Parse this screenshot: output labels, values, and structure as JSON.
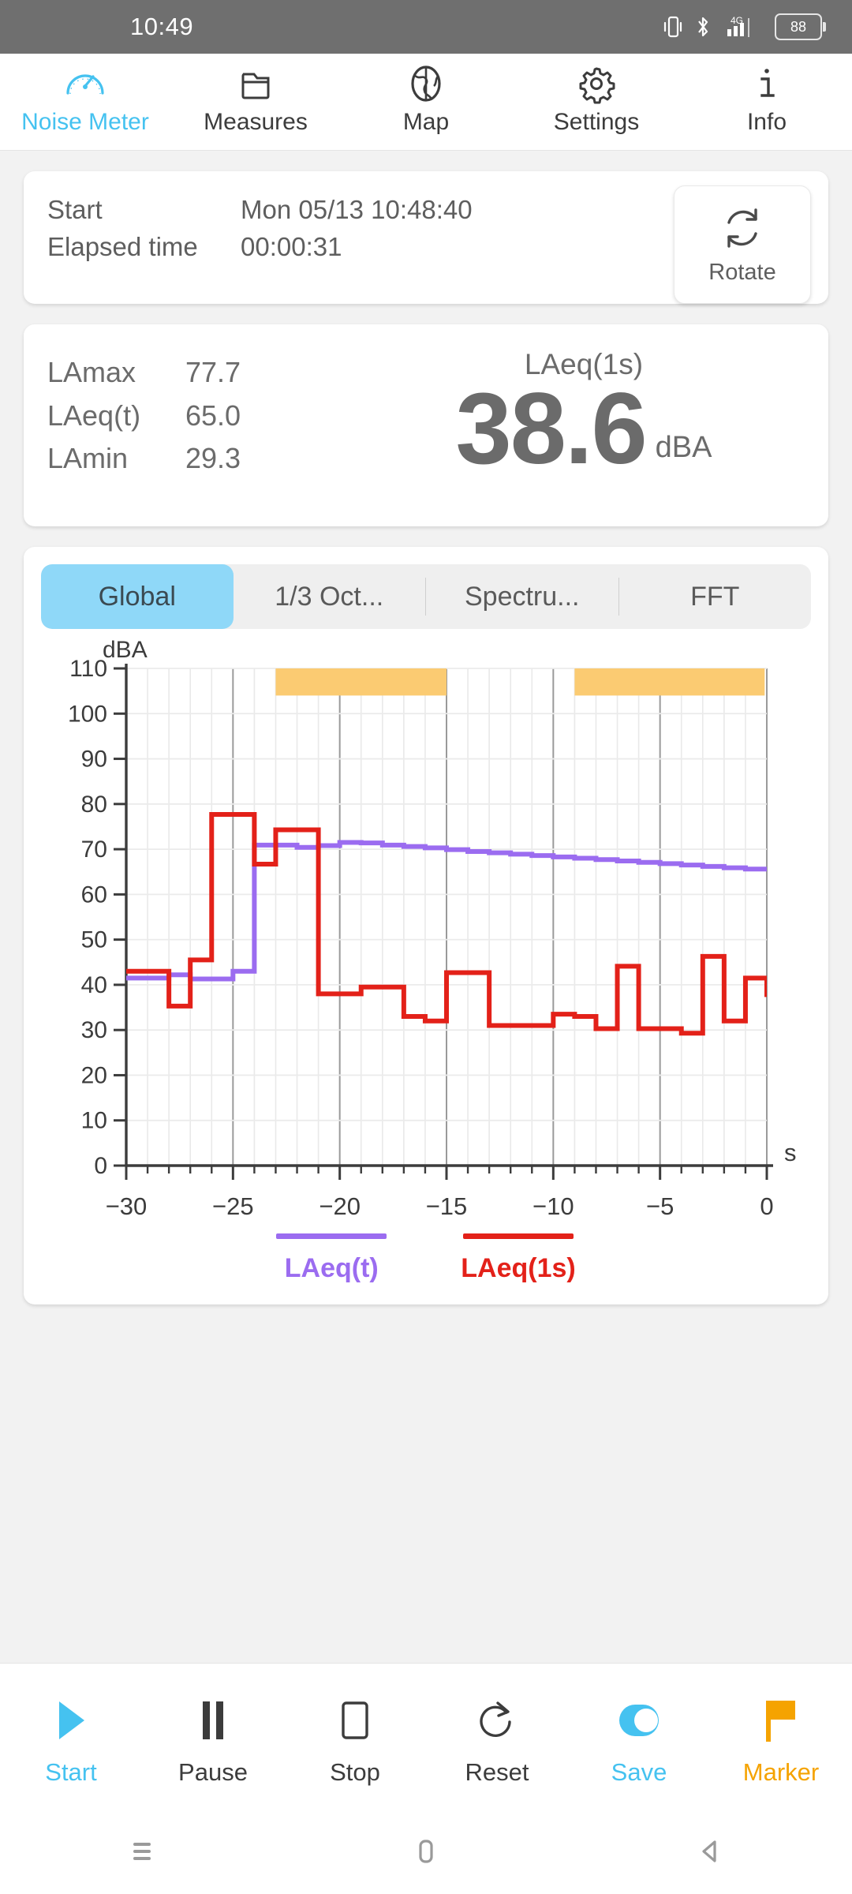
{
  "statusbar": {
    "time": "10:49",
    "battery": "88",
    "network": "4G",
    "icons": [
      "vibrate-icon",
      "bluetooth-icon",
      "signal-icon",
      "battery-icon"
    ]
  },
  "topnav": {
    "items": [
      {
        "label": "Noise Meter",
        "icon": "gauge-icon",
        "active": true
      },
      {
        "label": "Measures",
        "icon": "folder-icon",
        "active": false
      },
      {
        "label": "Map",
        "icon": "globe-icon",
        "active": false
      },
      {
        "label": "Settings",
        "icon": "gear-icon",
        "active": false
      },
      {
        "label": "Info",
        "icon": "info-icon",
        "active": false
      }
    ],
    "active_color": "#45c2f0"
  },
  "session": {
    "start_label": "Start",
    "start_value": "Mon 05/13 10:48:40",
    "elapsed_label": "Elapsed time",
    "elapsed_value": "00:00:31",
    "rotate_label": "Rotate",
    "rotate_icon": "rotate-icon"
  },
  "levels": {
    "lamax_label": "LAmax",
    "lamax_value": "77.7",
    "laeqt_label": "LAeq(t)",
    "laeqt_value": "65.0",
    "lamin_label": "LAmin",
    "lamin_value": "29.3",
    "current_title": "LAeq(1s)",
    "current_value": "38.6",
    "current_unit": "dBA"
  },
  "chart_tabs": {
    "items": [
      {
        "label": "Global",
        "active": true
      },
      {
        "label": "1/3 Oct...",
        "active": false
      },
      {
        "label": "Spectru...",
        "active": false
      },
      {
        "label": "FFT",
        "active": false
      }
    ],
    "active_bg": "#8fd8f8"
  },
  "legend": [
    {
      "label": "LAeq(t)",
      "color": "#9b6cf0"
    },
    {
      "label": "LAeq(1s)",
      "color": "#e32119"
    }
  ],
  "chart_data": {
    "type": "line",
    "title": "",
    "ylabel": "dBA",
    "xlabel": "s",
    "ylim": [
      0,
      110
    ],
    "xlim": [
      -30,
      0
    ],
    "ytick_step": 10,
    "yticks": [
      0,
      10,
      20,
      30,
      40,
      50,
      60,
      70,
      80,
      90,
      100,
      110
    ],
    "xticks": [
      -30,
      -25,
      -20,
      -15,
      -10,
      -5,
      0
    ],
    "xtick_minor_step": 1,
    "grid": true,
    "step_style": "post",
    "series": [
      {
        "name": "LAeq(t)",
        "color": "#9b6cf0",
        "x": [
          -30,
          -29,
          -28,
          -27,
          -26,
          -25,
          -24,
          -23,
          -22,
          -21,
          -20,
          -19,
          -18,
          -17,
          -16,
          -15,
          -14,
          -13,
          -12,
          -11,
          -10,
          -9,
          -8,
          -7,
          -6,
          -5,
          -4,
          -3,
          -2,
          -1,
          0
        ],
        "values": [
          41.5,
          41.5,
          42.2,
          41.3,
          41.3,
          43.0,
          70.9,
          70.9,
          70.4,
          70.8,
          71.5,
          71.4,
          70.9,
          70.6,
          70.3,
          69.9,
          69.5,
          69.2,
          68.9,
          68.6,
          68.3,
          68.0,
          67.7,
          67.4,
          67.1,
          66.8,
          66.5,
          66.2,
          65.9,
          65.6,
          65.3
        ]
      },
      {
        "name": "LAeq(1s)",
        "color": "#e32119",
        "x": [
          -30,
          -29,
          -28,
          -27,
          -26,
          -25,
          -24,
          -23,
          -22,
          -21,
          -20,
          -19,
          -18,
          -17,
          -16,
          -15,
          -14,
          -13,
          -12,
          -11,
          -10,
          -9,
          -8,
          -7,
          -6,
          -5,
          -4,
          -3,
          -2,
          -1,
          0
        ],
        "values": [
          43.0,
          43.0,
          35.3,
          45.5,
          77.7,
          77.7,
          66.7,
          74.3,
          74.3,
          38.0,
          38.0,
          39.5,
          39.5,
          33.0,
          32.0,
          42.7,
          42.7,
          31.0,
          31.0,
          31.0,
          33.5,
          33.0,
          30.3,
          44.1,
          30.3,
          30.3,
          29.3,
          46.3,
          32.0,
          41.5,
          37.3
        ]
      }
    ],
    "markers": [
      {
        "label": "marker-band-1",
        "x_start": -23.0,
        "x_end": -15.0,
        "color": "#fbcb72",
        "y_start": 104,
        "y_end": 110
      },
      {
        "label": "marker-band-2",
        "x_start": -9.0,
        "x_end": -0.1,
        "color": "#fbcb72",
        "y_start": 104,
        "y_end": 110
      }
    ]
  },
  "toolbar": {
    "items": [
      {
        "label": "Start",
        "icon": "play-icon",
        "color": "#45c2f0"
      },
      {
        "label": "Pause",
        "icon": "pause-icon",
        "color": "#3c3c3c"
      },
      {
        "label": "Stop",
        "icon": "stop-icon",
        "color": "#3c3c3c"
      },
      {
        "label": "Reset",
        "icon": "reset-icon",
        "color": "#3c3c3c"
      },
      {
        "label": "Save",
        "icon": "toggle-on-icon",
        "color": "#45c2f0"
      },
      {
        "label": "Marker",
        "icon": "flag-icon",
        "color": "#f5a300"
      }
    ]
  },
  "androidnav": {
    "items": [
      {
        "name": "recents-icon"
      },
      {
        "name": "home-icon"
      },
      {
        "name": "back-icon"
      }
    ]
  }
}
